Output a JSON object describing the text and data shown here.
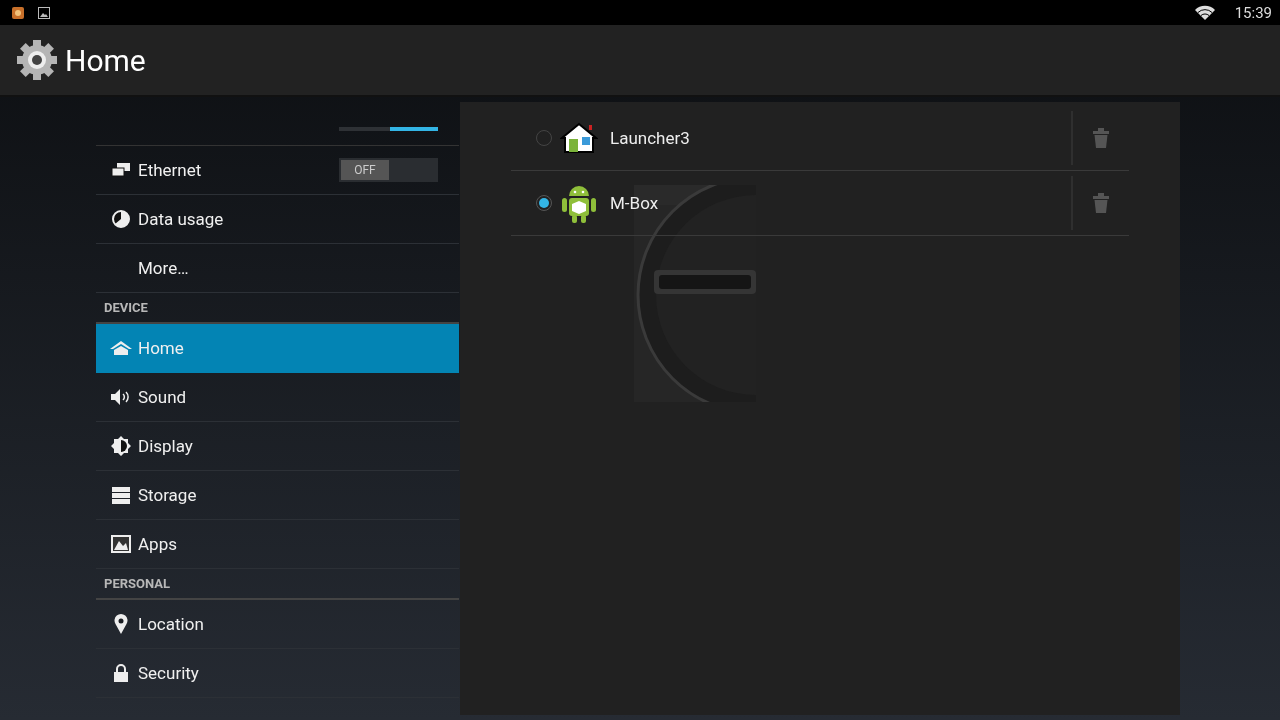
{
  "status_bar": {
    "time": "15:39"
  },
  "action_bar": {
    "title": "Home"
  },
  "sidebar": [
    {
      "kind": "switch_cut",
      "on": true
    },
    {
      "kind": "switch",
      "label": "Ethernet",
      "on": false,
      "switch_label": "OFF"
    },
    {
      "kind": "item",
      "label": "Data usage",
      "selected": false
    },
    {
      "kind": "item",
      "label": "More…",
      "selected": false
    },
    {
      "kind": "header",
      "label": "DEVICE"
    },
    {
      "kind": "item",
      "label": "Home",
      "selected": true
    },
    {
      "kind": "item",
      "label": "Sound",
      "selected": false
    },
    {
      "kind": "item",
      "label": "Display",
      "selected": false
    },
    {
      "kind": "item",
      "label": "Storage",
      "selected": false
    },
    {
      "kind": "item",
      "label": "Apps",
      "selected": false
    },
    {
      "kind": "header",
      "label": "PERSONAL"
    },
    {
      "kind": "item",
      "label": "Location",
      "selected": false
    },
    {
      "kind": "item",
      "label": "Security",
      "selected": false
    }
  ],
  "home_apps": [
    {
      "name": "Launcher3",
      "selected": false
    },
    {
      "name": "M-Box",
      "selected": true
    }
  ]
}
